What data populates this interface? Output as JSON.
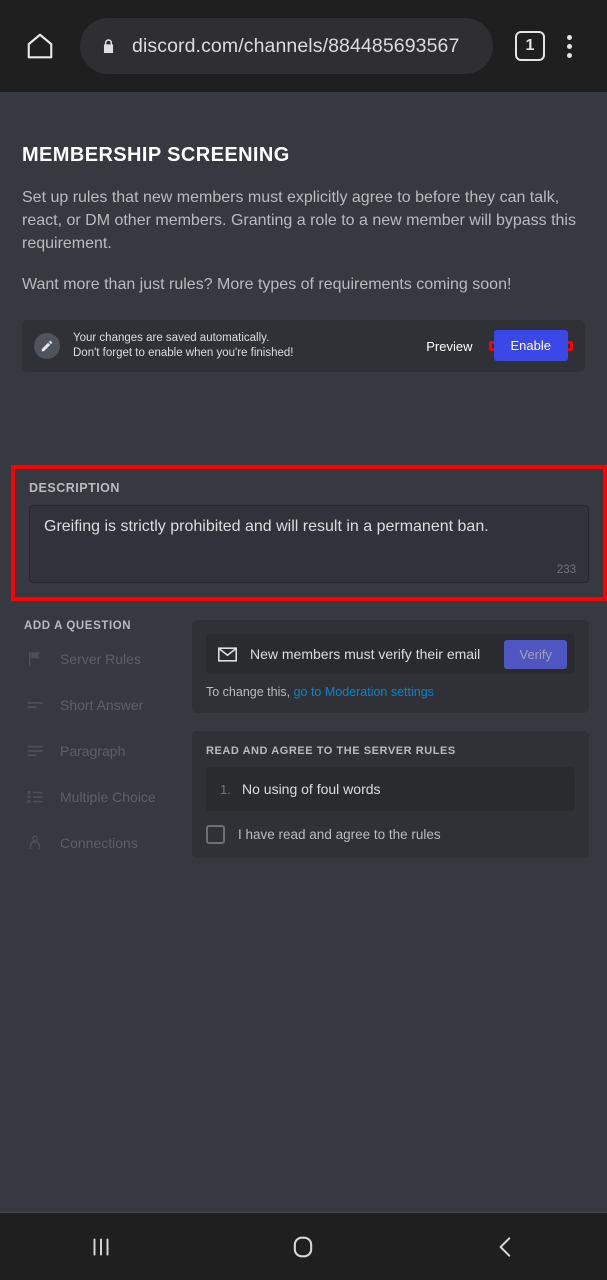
{
  "browser": {
    "home_icon": "home-icon",
    "lock_icon": "lock-icon",
    "url": "discord.com/channels/884485693567",
    "tab_count": "1",
    "menu_icon": "kebab-menu-icon"
  },
  "page": {
    "title": "MEMBERSHIP SCREENING",
    "paragraph1": "Set up rules that new members must explicitly agree to before they can talk, react, or DM other members. Granting a role to a new member will bypass this requirement.",
    "paragraph2": "Want more than just rules? More types of requirements coming soon!"
  },
  "save_bar": {
    "icon": "pencil-icon",
    "line1": "Your changes are saved automatically.",
    "line2": "Don't forget to enable when you're finished!",
    "preview_label": "Preview",
    "enable_label": "Enable",
    "enable_color": "#3b48e8",
    "highlight_color": "#ff0000"
  },
  "description": {
    "label": "DESCRIPTION",
    "value": "Greifing is strictly prohibited and will result in a permanent ban.",
    "char_count": "233",
    "highlight_color": "#ff0000"
  },
  "add_question": {
    "title": "ADD A QUESTION",
    "items": [
      {
        "label": "Server Rules",
        "icon": "flag-icon"
      },
      {
        "label": "Short Answer",
        "icon": "short-answer-icon"
      },
      {
        "label": "Paragraph",
        "icon": "paragraph-icon"
      },
      {
        "label": "Multiple Choice",
        "icon": "list-icon"
      },
      {
        "label": "Connections",
        "icon": "connections-icon"
      }
    ]
  },
  "email_card": {
    "icon": "mail-icon",
    "label": "New members must verify their email",
    "button_label": "Verify",
    "note_prefix": "To change this, ",
    "note_link": "go to Moderation settings"
  },
  "rules_card": {
    "title": "READ AND AGREE TO THE SERVER RULES",
    "rules": [
      {
        "number": "1.",
        "text": "No using of foul words"
      }
    ],
    "agree_label": "I have read and agree to the rules",
    "agree_checked": false
  },
  "navbar": {
    "recents_icon": "recents-icon",
    "home_icon": "home-square-icon",
    "back_icon": "back-chevron-icon"
  }
}
